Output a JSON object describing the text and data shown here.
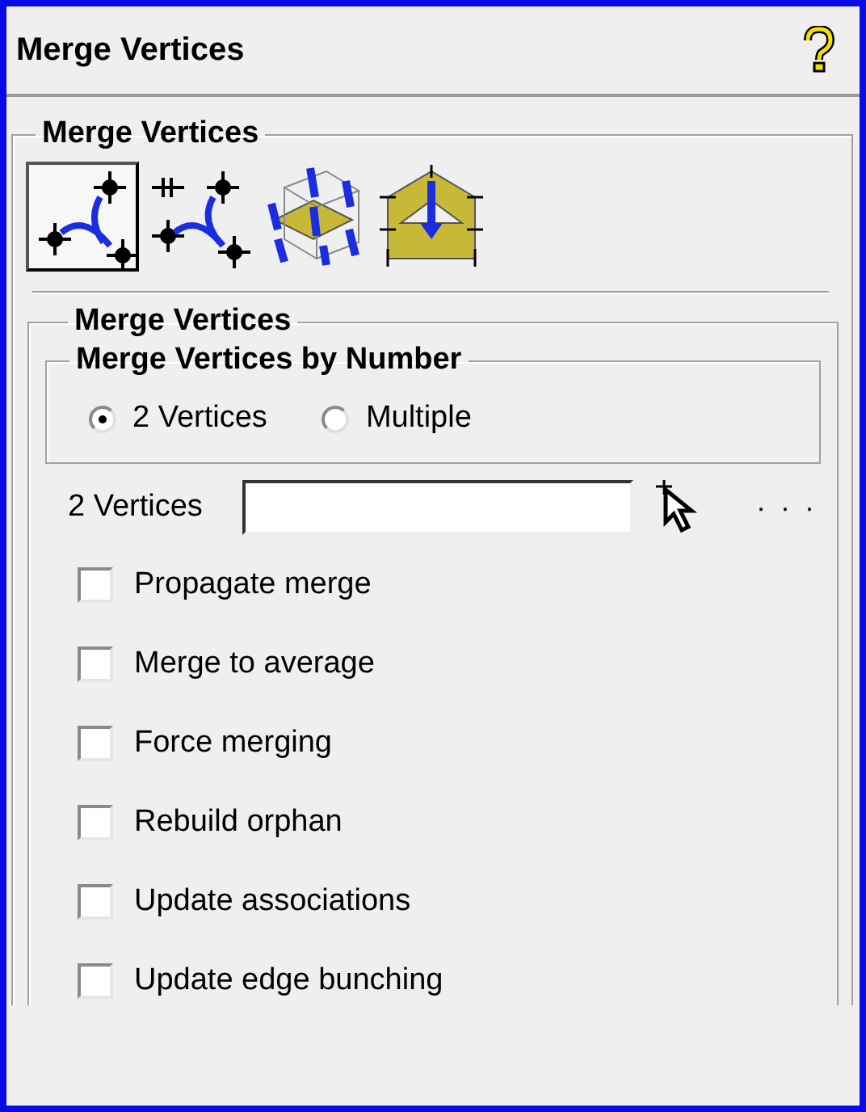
{
  "window": {
    "title": "Merge Vertices"
  },
  "group": {
    "title": "Merge Vertices"
  },
  "tools": [
    {
      "selected": true
    },
    {
      "selected": false
    },
    {
      "selected": false
    },
    {
      "selected": false
    }
  ],
  "section": {
    "title": "Merge Vertices"
  },
  "by_number": {
    "title": "Merge Vertices by Number",
    "options": [
      {
        "label": "2 Vertices",
        "selected": true
      },
      {
        "label": "Multiple",
        "selected": false
      }
    ]
  },
  "vertices_field": {
    "label": "2 Vertices",
    "more": "· · ·"
  },
  "options": [
    {
      "label": "Propagate merge",
      "checked": false
    },
    {
      "label": "Merge to average",
      "checked": false
    },
    {
      "label": "Force merging",
      "checked": false
    },
    {
      "label": "Rebuild orphan",
      "checked": false
    },
    {
      "label": "Update associations",
      "checked": false
    },
    {
      "label": "Update edge bunching",
      "checked": false
    }
  ]
}
